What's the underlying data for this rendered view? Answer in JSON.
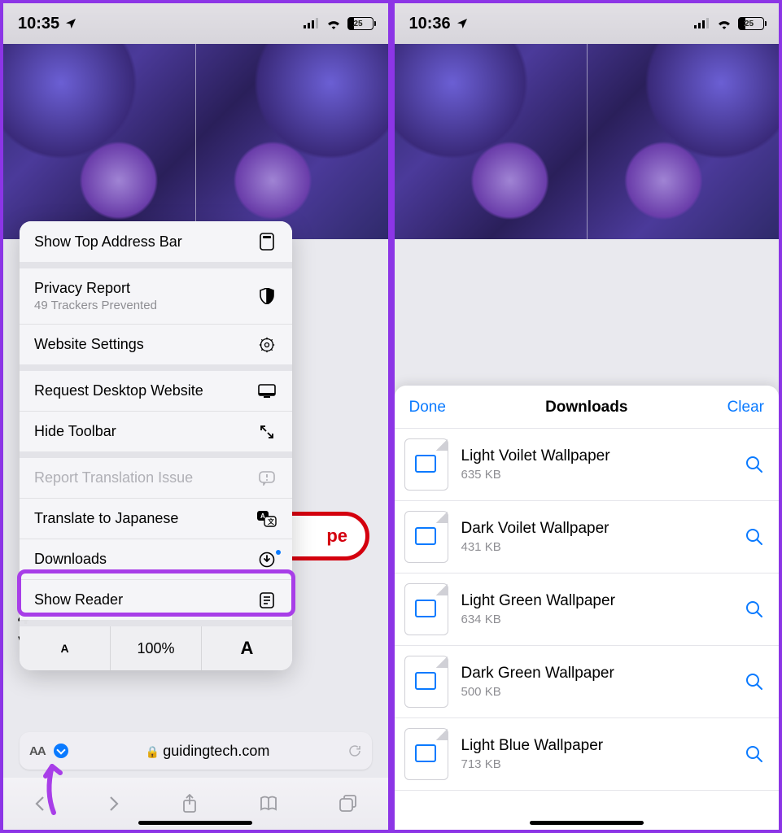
{
  "left": {
    "status": {
      "time": "10:35",
      "battery": "25"
    },
    "menu": {
      "show_top": "Show Top Address Bar",
      "privacy": {
        "title": "Privacy Report",
        "sub": "49 Trackers Prevented"
      },
      "website_settings": "Website Settings",
      "request_desktop": "Request Desktop Website",
      "hide_toolbar": "Hide Toolbar",
      "report_translation": "Report Translation Issue",
      "translate": "Translate to Japanese",
      "downloads": "Downloads",
      "show_reader": "Show Reader",
      "zoom": "100%"
    },
    "bg": {
      "red_suffix": "pe",
      "num": "4",
      "letter": "V"
    },
    "url": "guidingtech.com"
  },
  "right": {
    "status": {
      "time": "10:36",
      "battery": "25"
    },
    "sheet": {
      "done": "Done",
      "title": "Downloads",
      "clear": "Clear",
      "items": [
        {
          "name": "Light Voilet Wallpaper",
          "size": "635 KB"
        },
        {
          "name": "Dark Voilet Wallpaper",
          "size": "431 KB"
        },
        {
          "name": "Light Green Wallpaper",
          "size": "634 KB"
        },
        {
          "name": "Dark Green Wallpaper",
          "size": "500 KB"
        },
        {
          "name": "Light Blue Wallpaper",
          "size": "713 KB"
        }
      ]
    }
  }
}
